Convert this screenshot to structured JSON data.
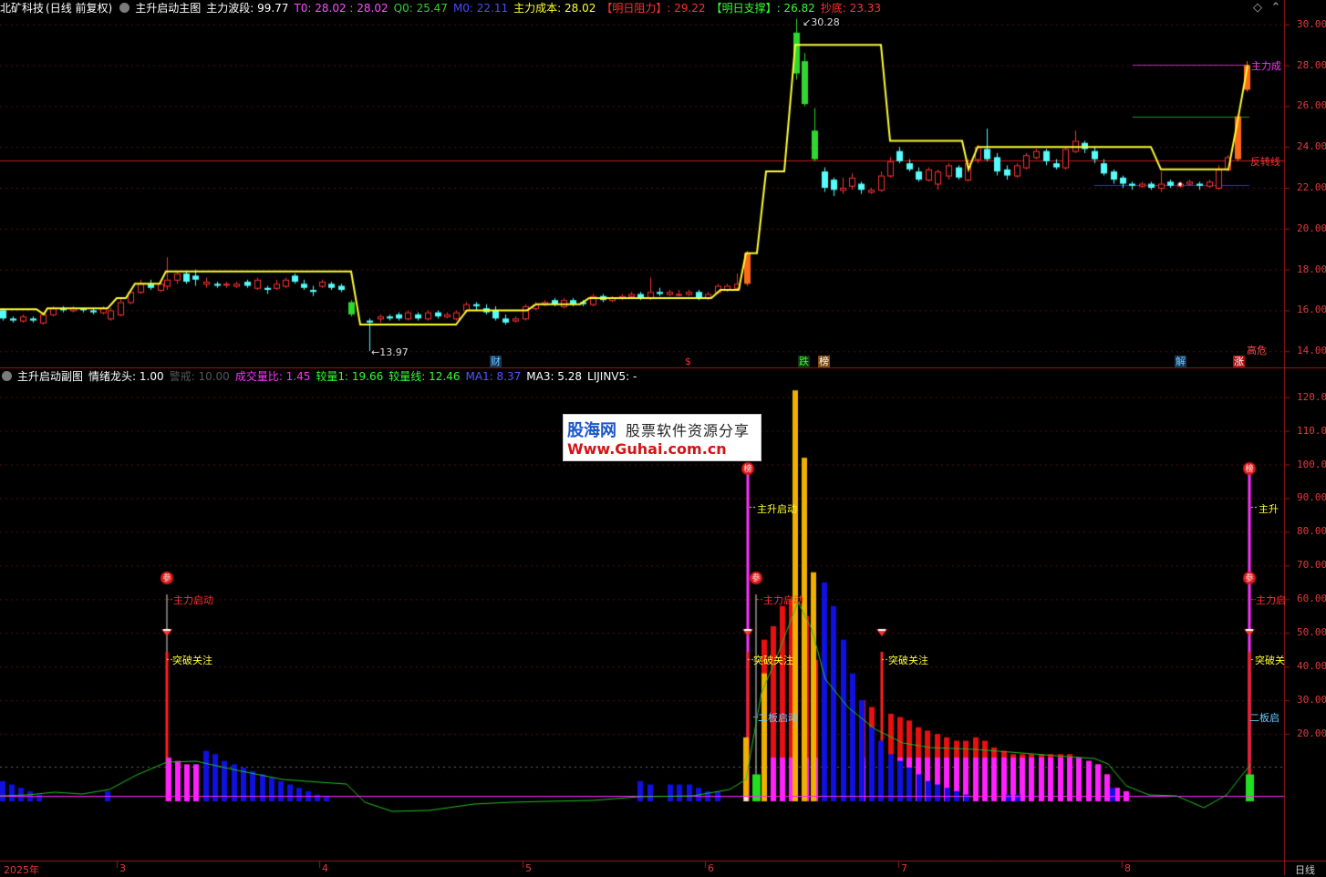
{
  "top": {
    "stock_name": "北矿科技",
    "period": "(日线 前复权)",
    "indicator": "主升启动主图",
    "items": [
      {
        "label": "主力波段: ",
        "value": "99.77",
        "color": "#ffffff"
      },
      {
        "label": "T0: ",
        "value": "28.02 : 28.02",
        "color": "#ff4dff"
      },
      {
        "label": "Q0: ",
        "value": "25.47",
        "color": "#2fd32f"
      },
      {
        "label": "M0: ",
        "value": "22.11",
        "color": "#4a4aff"
      },
      {
        "label": "主力成本: ",
        "value": "28.02",
        "color": "#ffff33"
      },
      {
        "label": "【明日阻力】: ",
        "value": "29.22",
        "color": "#ff3030"
      },
      {
        "label": "【明日支撑】: ",
        "value": "26.82",
        "color": "#33ff33"
      },
      {
        "label": "抄底: ",
        "value": "23.33",
        "color": "#ff3030"
      }
    ],
    "y_axis": [
      "30.00",
      "28.00",
      "26.00",
      "24.00",
      "22.00",
      "20.00",
      "18.00",
      "16.00",
      "14.00"
    ],
    "high_label": "30.28",
    "low_label": "13.97",
    "line_labels": {
      "main_cost": "主力成",
      "reversal": "反转线"
    },
    "event_tags": [
      {
        "text": "财",
        "color": "#66ccff",
        "bg": "#1a3355"
      },
      {
        "text": "$",
        "color": "#ff3030",
        "bg": "transparent"
      },
      {
        "text": "跌",
        "color": "#33ff33",
        "bg": "#113311"
      },
      {
        "text": "榜",
        "color": "#ffffff",
        "bg": "#7a4a10"
      },
      {
        "text": "解",
        "color": "#66ccff",
        "bg": "#1a3355"
      },
      {
        "text": "涨",
        "color": "#ffffff",
        "bg": "#aa1111"
      },
      {
        "text": "高危",
        "color": "#ff4d4d",
        "bg": "transparent"
      }
    ]
  },
  "sub": {
    "indicator": "主升启动副图",
    "items": [
      {
        "label": "情绪龙头: ",
        "value": "1.00",
        "color": "#ffffff"
      },
      {
        "label": "警戒: ",
        "value": "10.00",
        "color": "#555555"
      },
      {
        "label": "成交量比: ",
        "value": "1.45",
        "color": "#ff33ff"
      },
      {
        "label": "较量1: ",
        "value": "19.66",
        "color": "#33ff33"
      },
      {
        "label": "较量线: ",
        "value": "12.46",
        "color": "#33ff33"
      },
      {
        "label": "MA1: ",
        "value": "8.37",
        "color": "#5555ff"
      },
      {
        "label": "MA3: ",
        "value": "5.28",
        "color": "#ffffff"
      },
      {
        "label": "LIJINV5: ",
        "value": "-",
        "color": "#ffffff"
      }
    ],
    "y_axis": [
      "120.00",
      "110.00",
      "100.00",
      "90.00",
      "80.00",
      "70.00",
      "60.00",
      "50.00",
      "40.00",
      "30.00",
      "20.00"
    ],
    "signal_labels": {
      "main_start": "主力启动",
      "breakout": "突破关注",
      "main_rise": "主升启动",
      "board_start": "二板启动",
      "board_start_cut": "二板启",
      "main_rise_cut": "主升",
      "main_start_cut": "主力启",
      "breakout_cut": "突破关"
    },
    "badges": {
      "bang": "榜",
      "shen": "参"
    }
  },
  "x_axis": {
    "labels": [
      "2025年",
      "3",
      "4",
      "5",
      "6",
      "7",
      "8"
    ],
    "period": "日线"
  },
  "watermark": {
    "brand": "股海网",
    "slogan": "股票软件资源分享",
    "url": "Www.Guhai.com.cn"
  },
  "colors": {
    "up": "#ff3232",
    "down": "#54fcfc",
    "yellow_line": "#ffff33",
    "axis": "#a01818",
    "grid": "#5a1010"
  }
}
